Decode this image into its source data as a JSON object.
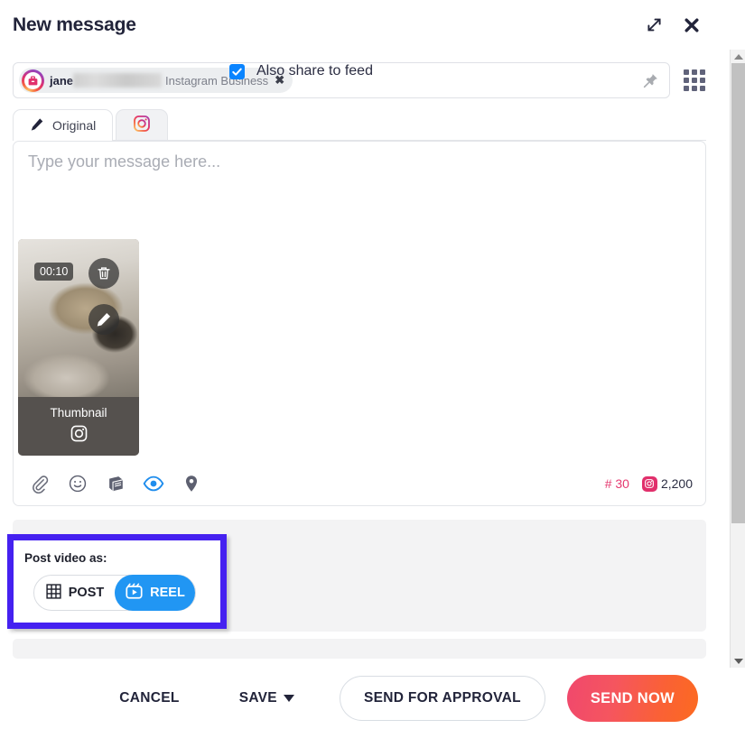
{
  "window": {
    "title": "New message",
    "expand_icon": "expand-icon",
    "close_icon": "close-icon"
  },
  "recipient": {
    "chip": {
      "avatar_icon": "instagram-business-avatar-icon",
      "name": "jane",
      "redacted": "",
      "account_type": "Instagram Business",
      "remove_label": "✖"
    },
    "pin_icon": "pushpin-icon",
    "apps_icon": "apps-grid-icon"
  },
  "tabs": [
    {
      "label": "Original",
      "icon": "pencil-icon",
      "active": true
    },
    {
      "label": "",
      "icon": "instagram-icon",
      "active": false
    }
  ],
  "compose": {
    "placeholder": "Type your message here...",
    "media": {
      "duration": "00:10",
      "thumbnail_label": "Thumbnail",
      "thumbnail_network_icon": "instagram-icon",
      "delete_icon": "trash-icon",
      "edit_icon": "pencil-edit-icon"
    },
    "toolbar_icons": [
      "attachment-icon",
      "emoji-icon",
      "library-icon",
      "preview-eye-icon",
      "location-pin-icon"
    ],
    "counters": {
      "hashtag": "# 30",
      "instagram_chars": "2,200"
    }
  },
  "options": {
    "post_video_as_label": "Post video as:",
    "segments": [
      {
        "label": "POST",
        "icon": "grid-icon",
        "selected": false
      },
      {
        "label": "REEL",
        "icon": "reel-icon",
        "selected": true
      }
    ],
    "also_share_to_feed": {
      "label": "Also share to feed",
      "checked": true
    }
  },
  "footer": {
    "cancel_label": "CANCEL",
    "save_label": "SAVE",
    "send_for_approval_label": "SEND FOR APPROVAL",
    "send_now_label": "SEND NOW"
  },
  "colors": {
    "highlight_border": "#4521f0",
    "reel_active": "#2196f3",
    "checkbox": "#0a84ff",
    "send_now_gradient_start": "#f0486d",
    "send_now_gradient_end": "#fc6a20",
    "counter_accent": "#e53970",
    "preview_eye_active": "#1f8ded"
  },
  "scrollbar": {
    "up_icon": "scroll-up-icon",
    "down_icon": "scroll-down-icon"
  }
}
